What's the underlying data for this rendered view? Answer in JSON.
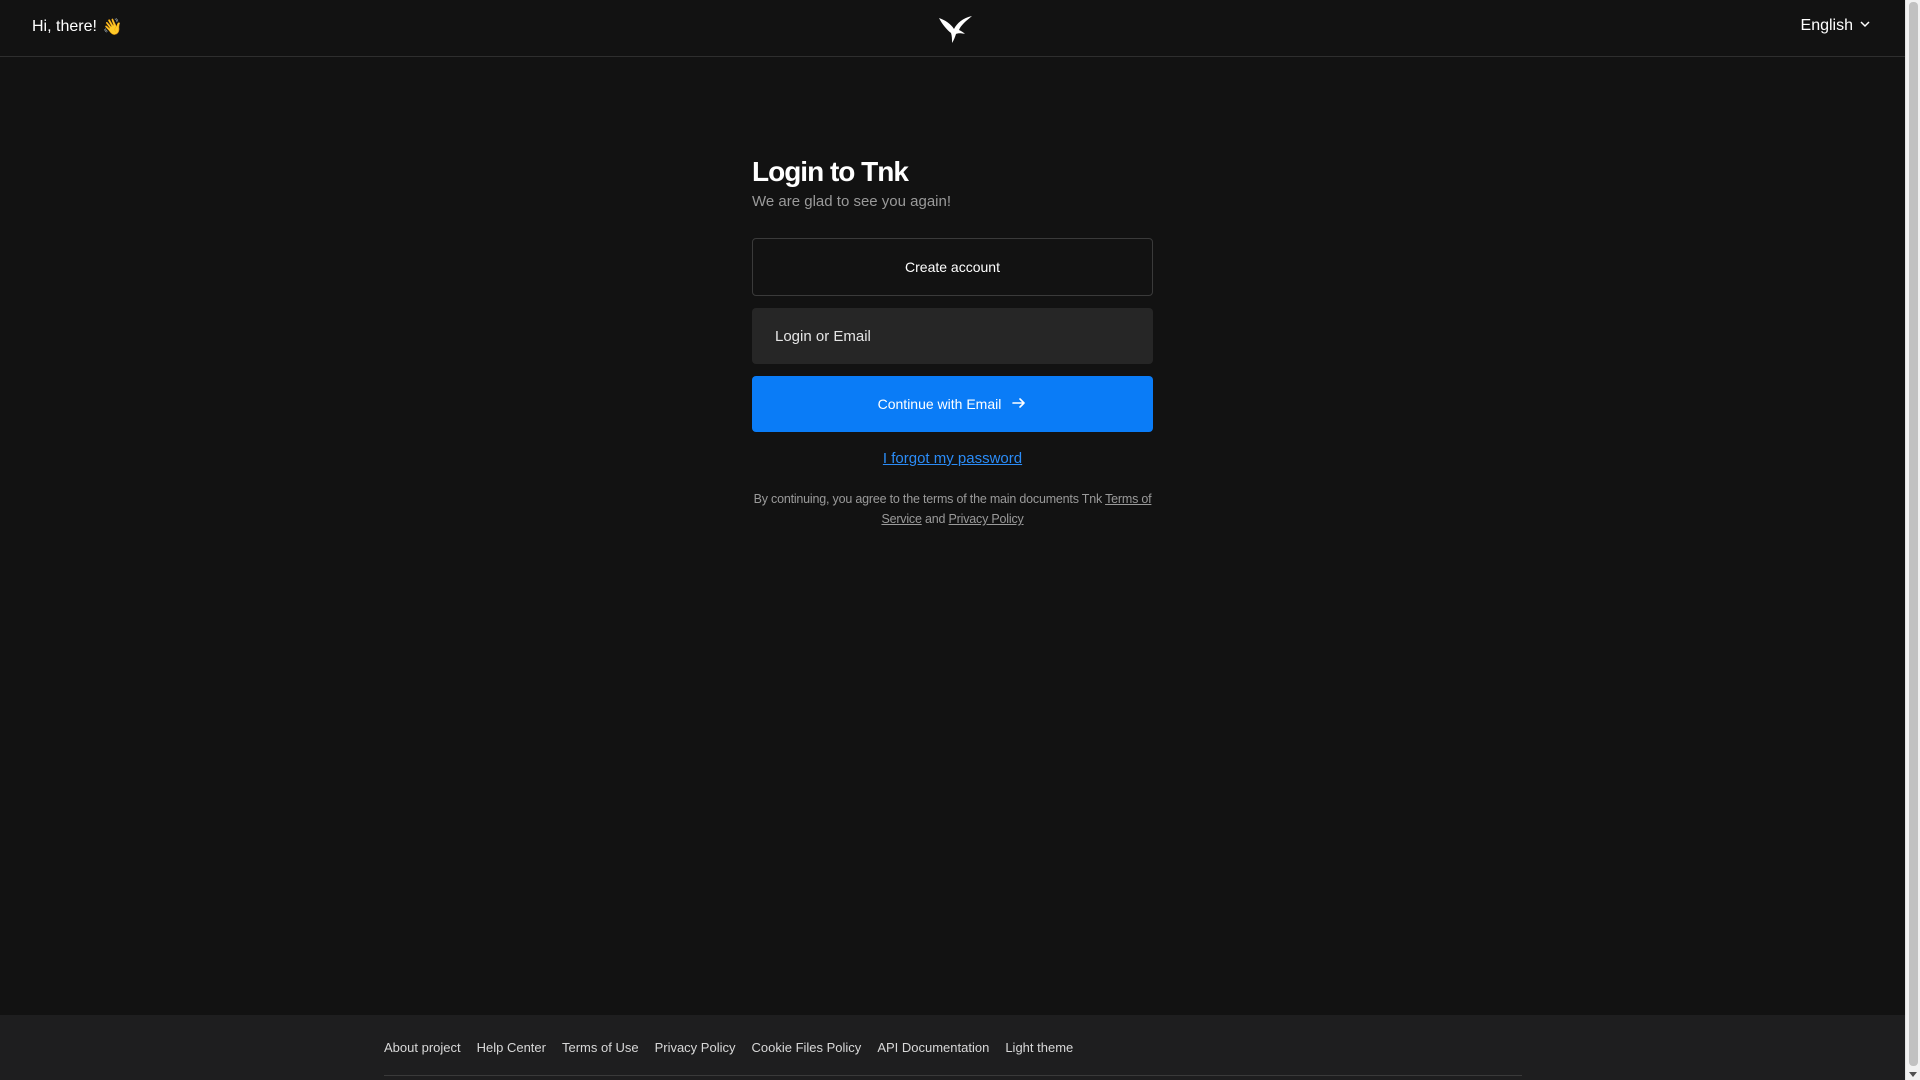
{
  "header": {
    "greeting": "Hi, there!",
    "greeting_emoji": "👋",
    "logo_icon": "bird-logo-icon",
    "language": "English"
  },
  "login": {
    "title": "Login to Tnk",
    "subtitle": "We are glad to see you again!",
    "create_account_label": "Create account",
    "email_placeholder": "Login or Email",
    "email_value": "",
    "continue_label": "Continue with Email",
    "forgot_label": "I forgot my password",
    "terms_prefix": "By continuing, you agree to the terms of the main documents Tnk ",
    "terms_link": "Terms of Service",
    "terms_and": " and ",
    "privacy_link": "Privacy Policy"
  },
  "footer": {
    "links": [
      "About project",
      "Help Center",
      "Terms of Use",
      "Privacy Policy",
      "Cookie Files Policy",
      "API Documentation",
      "Light theme"
    ]
  },
  "colors": {
    "background": "#121212",
    "accent": "#0a7cf7",
    "link": "#2b8cf7",
    "footer_bg": "#1e1e1f"
  }
}
